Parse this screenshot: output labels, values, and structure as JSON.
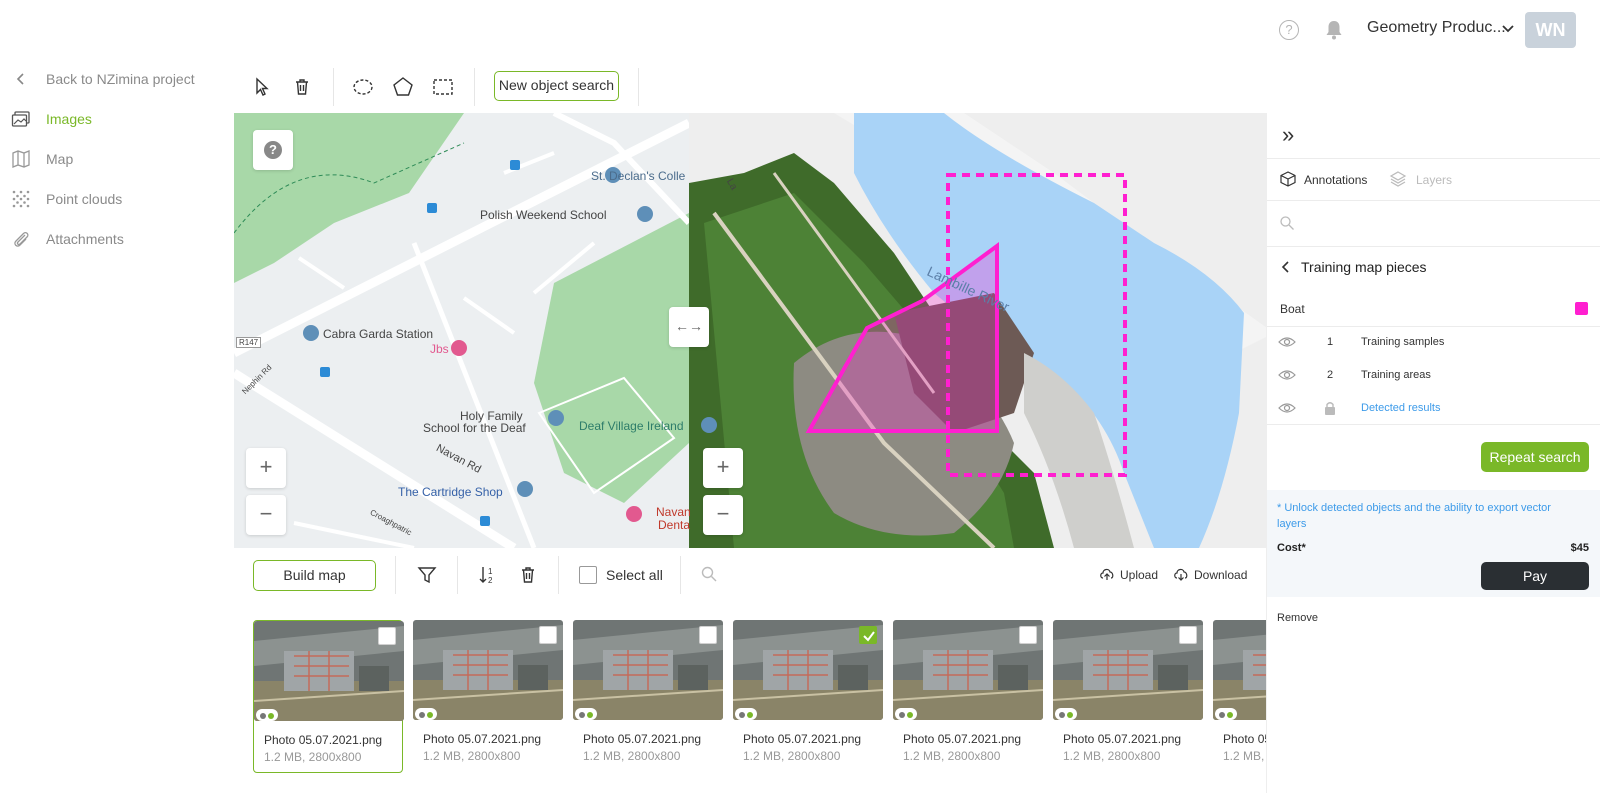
{
  "header": {
    "help_glyph": "?",
    "project_name": "Geometry Produc...",
    "avatar_initials": "WN"
  },
  "sidebar": {
    "back_label": "Back to NZimina project",
    "items": [
      {
        "label": "Images",
        "icon": "images-icon",
        "active": true
      },
      {
        "label": "Map",
        "icon": "map-icon",
        "active": false
      },
      {
        "label": "Point clouds",
        "icon": "point-cloud-icon",
        "active": false
      },
      {
        "label": "Attachments",
        "icon": "paperclip-icon",
        "active": false
      }
    ]
  },
  "toolbar": {
    "new_object_search_label": "New object search",
    "tools": [
      "cursor-icon",
      "trash-icon",
      "ellipse-icon",
      "polygon-icon",
      "rectangle-icon"
    ]
  },
  "map": {
    "help_glyph": "?",
    "compare_glyph": "←→",
    "zoom_in": "+",
    "zoom_out": "−",
    "labels": {
      "st_declans": "St. Declan's Colle",
      "polish_school": "Polish Weekend School",
      "cabra": "Cabra Garda Station",
      "jbs": "Jbs",
      "holy_family_1": "Holy Family",
      "holy_family_2": "School for the Deaf",
      "deaf_village": "Deaf Village Ireland",
      "navan_rd": "Navan Rd",
      "cartridge": "The Cartridge Shop",
      "nephin": "Nephin Rd",
      "r147": "R147",
      "croaghpatrick": "Croaghpatric",
      "navan_dental_1": "Navan",
      "navan_dental_2": "Denta",
      "lamb_river": "Lambille River",
      "la_label": "La"
    },
    "colors": {
      "annotation": "#ff1fd0",
      "park": "#a8d8a8",
      "river": "#a9d3f7"
    }
  },
  "strip": {
    "build_map_label": "Build map",
    "select_all_label": "Select all",
    "upload_label": "Upload",
    "download_label": "Download"
  },
  "gallery": {
    "photos": [
      {
        "name": "Photo 05.07.2021.png",
        "meta": "1.2 MB, 2800x800",
        "selected": true,
        "checked": false
      },
      {
        "name": "Photo 05.07.2021.png",
        "meta": "1.2 MB, 2800x800",
        "selected": false,
        "checked": false
      },
      {
        "name": "Photo 05.07.2021.png",
        "meta": "1.2 MB, 2800x800",
        "selected": false,
        "checked": false
      },
      {
        "name": "Photo 05.07.2021.png",
        "meta": "1.2 MB, 2800x800",
        "selected": false,
        "checked": true
      },
      {
        "name": "Photo 05.07.2021.png",
        "meta": "1.2 MB, 2800x800",
        "selected": false,
        "checked": false
      },
      {
        "name": "Photo 05.07.2021.png",
        "meta": "1.2 MB, 2800x800",
        "selected": false,
        "checked": false
      },
      {
        "name": "Photo 05.07.2021.png",
        "meta": "1.2 MB, 2800x800",
        "selected": false,
        "checked": false
      }
    ]
  },
  "panel": {
    "collapse_glyph": "»",
    "tab_annotations": "Annotations",
    "tab_layers": "Layers",
    "search_placeholder": "",
    "section_title": "Training map pieces",
    "class_name": "Boat",
    "class_color": "#ff1fd0",
    "layers": [
      {
        "index": "1",
        "label": "Training samples",
        "locked": false
      },
      {
        "index": "2",
        "label": "Training areas",
        "locked": false
      },
      {
        "index": "",
        "label": "Detected results",
        "locked": true
      }
    ],
    "repeat_search_label": "Repeat search",
    "unlock_note": "* Unlock detected objects and the ability to export vector layers",
    "cost_label": "Cost*",
    "cost_value": "$45",
    "pay_label": "Pay",
    "remove_label": "Remove"
  }
}
